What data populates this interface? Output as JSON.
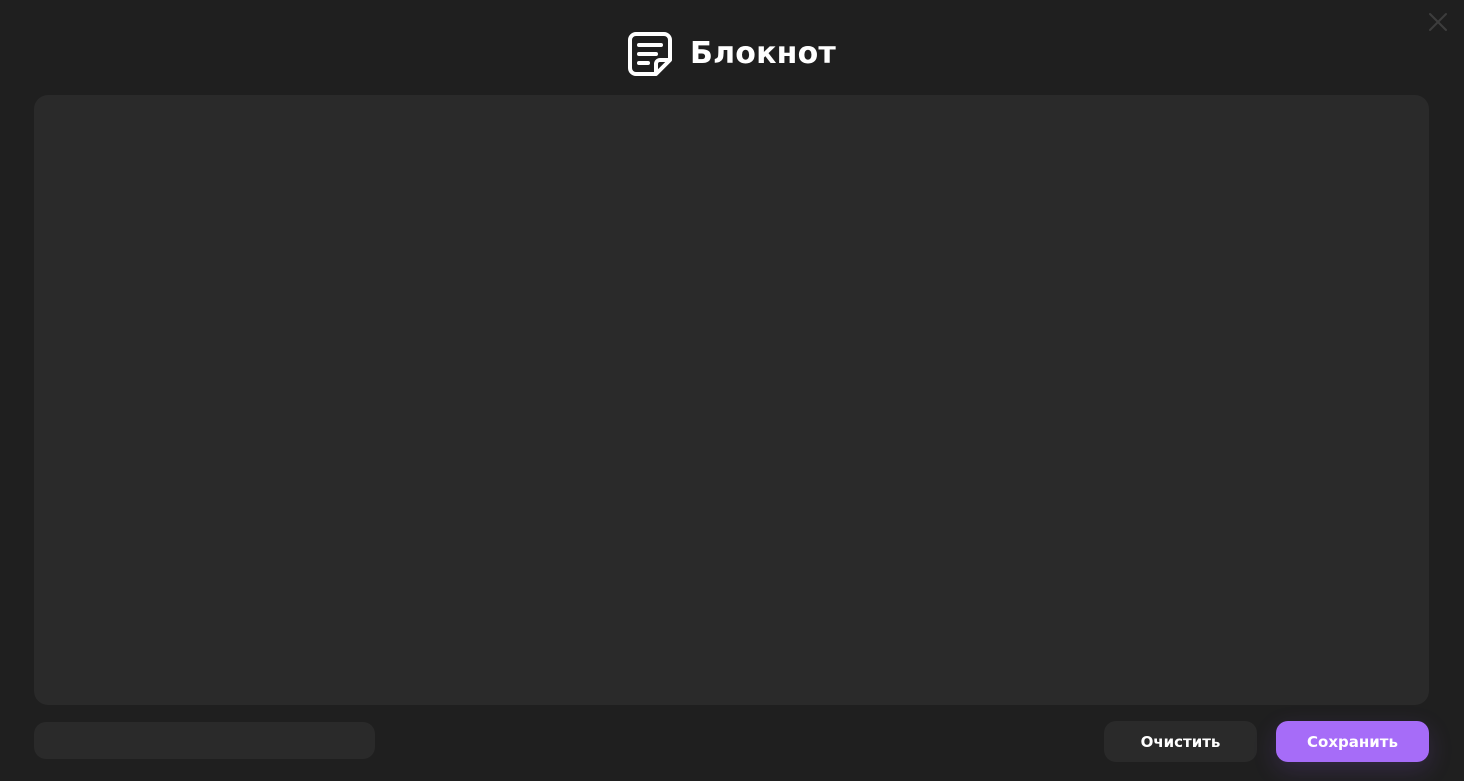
{
  "header": {
    "title": "Блокнот",
    "icon": "note-icon"
  },
  "window": {
    "close_icon": "close-icon"
  },
  "editor": {
    "value": "",
    "placeholder": ""
  },
  "status": {
    "text": ""
  },
  "actions": {
    "clear_label": "Очистить",
    "save_label": "Сохранить"
  },
  "colors": {
    "background": "#1f1f1f",
    "surface": "#2a2a2a",
    "accent": "#a66cf8",
    "text": "#ffffff"
  }
}
